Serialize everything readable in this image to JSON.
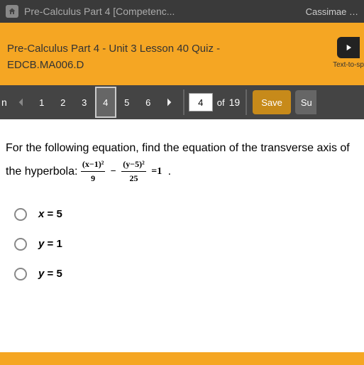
{
  "titlebar": {
    "title": "Pre-Calculus Part 4 [Competenc...",
    "user": "Cassimae …"
  },
  "header": {
    "line1": "Pre-Calculus Part 4 - Unit 3 Lesson 40 Quiz -",
    "line2": "EDCB.MA006.D",
    "tts_label": "Text-to-sp"
  },
  "nav": {
    "left_fragment": "n",
    "numbers": [
      "1",
      "2",
      "3",
      "4",
      "5",
      "6"
    ],
    "active": "4",
    "page_input": "4",
    "of_label": "of",
    "total": "19",
    "save_label": "Save",
    "submit_label": "Su"
  },
  "question": {
    "prompt_a": "For the following equation, find the equation of the transverse axis of",
    "prompt_b": "the hyperbola:",
    "eq_num1": "(x−1)²",
    "eq_den1": "9",
    "eq_minus": "−",
    "eq_num2": "(y−5)²",
    "eq_den2": "25",
    "eq_eq": "=1",
    "period": "."
  },
  "options": {
    "a_var": "x",
    "a_rest": " = 5",
    "b_var": "y",
    "b_rest": " = 1",
    "c_var": "y",
    "c_rest": " = 5"
  }
}
